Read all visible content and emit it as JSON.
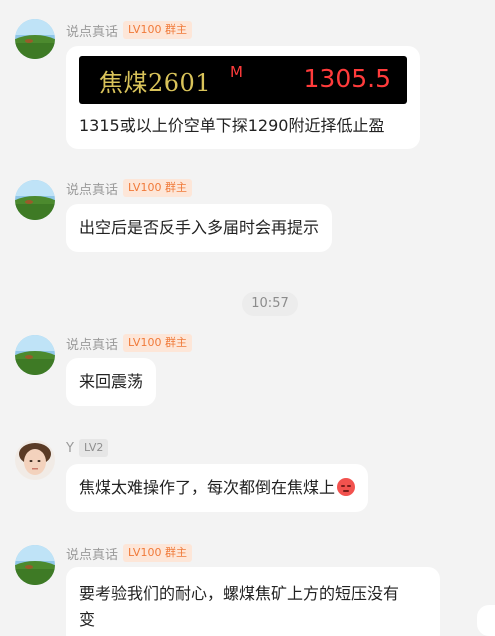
{
  "messages": [
    {
      "sender": "说点真话",
      "badge": "LV100 群主",
      "ticker": {
        "name": "焦煤2601",
        "flag": "M",
        "price": "1305.5"
      },
      "text": "1315或以上价空单下探1290附近择低止盈"
    },
    {
      "sender": "说点真话",
      "badge": "LV100 群主",
      "text": "出空后是否反手入多届时会再提示"
    },
    {
      "sender": "说点真话",
      "badge": "LV100 群主",
      "text": "来回震荡"
    },
    {
      "sender": "Y",
      "badge": "LV2",
      "text": "焦煤太难操作了，每次都倒在焦煤上",
      "emoji": "angry-face-emoji"
    },
    {
      "sender": "说点真话",
      "badge": "LV100 群主",
      "text_line1": "要考验我们的耐心，螺煤焦矿上方的短压没有",
      "text_line2": "变"
    }
  ],
  "timestamp": "10:57",
  "colors": {
    "background": "#f3f3f3",
    "bubble": "#ffffff",
    "owner_badge_bg": "#fde6d8",
    "owner_badge_text": "#f07a3a",
    "ticker_bg": "#000000",
    "ticker_name": "#d9c35a",
    "ticker_price": "#ff3b3b"
  }
}
